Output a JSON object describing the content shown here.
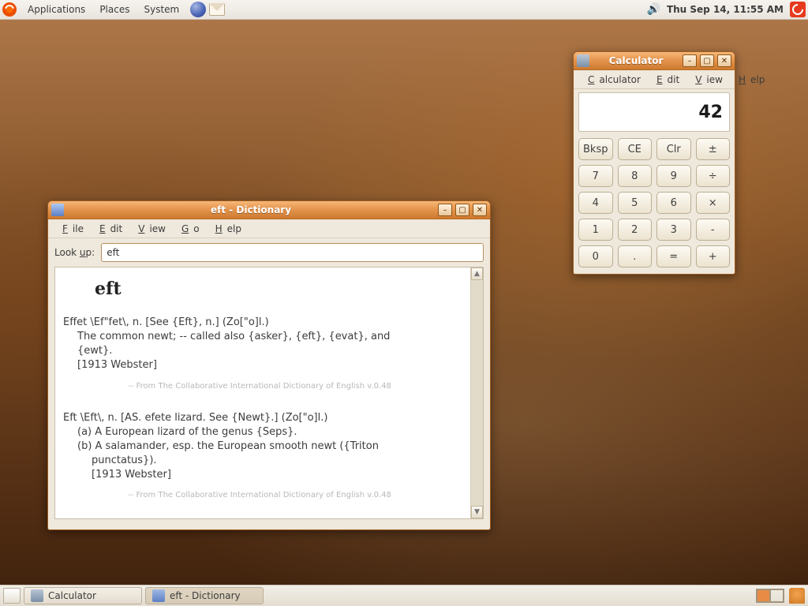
{
  "panel": {
    "menus": {
      "applications": "Applications",
      "places": "Places",
      "system": "System"
    },
    "clock": "Thu Sep 14, 11:55 AM"
  },
  "taskbar": {
    "tasks": [
      {
        "label": "Calculator",
        "active": false,
        "icon": "calc"
      },
      {
        "label": "eft - Dictionary",
        "active": true,
        "icon": "dict"
      }
    ]
  },
  "dictionary": {
    "title": "eft - Dictionary",
    "menus": {
      "file": "File",
      "edit": "Edit",
      "view": "View",
      "go": "Go",
      "help": "Help"
    },
    "lookup_label": "Look up:",
    "lookup_value": "eft",
    "headword": "eft",
    "entry1": {
      "line1": "Effet \\Ef\"fet\\, n. [See {Eft}, n.] (Zo[\"o]l.)",
      "line2": "The common newt; -- called also {asker}, {eft}, {evat}, and",
      "line3": "{ewt}.",
      "line4": "[1913 Webster]",
      "source": "-- From The Collaborative International Dictionary of English v.0.48"
    },
    "entry2": {
      "line1": "Eft \\Eft\\, n. [AS. efete lizard. See {Newt}.] (Zo[\"o]l.)",
      "line2": "(a) A European lizard of the genus {Seps}.",
      "line3": "(b) A salamander, esp. the European smooth newt ({Triton",
      "line4": "punctatus}).",
      "line5": "[1913 Webster]",
      "source": "-- From The Collaborative International Dictionary of English v.0.48"
    }
  },
  "calculator": {
    "title": "Calculator",
    "menus": {
      "calculator": "Calculator",
      "edit": "Edit",
      "view": "View",
      "help": "Help"
    },
    "display": "42",
    "buttons": {
      "bksp": "Bksp",
      "ce": "CE",
      "clr": "Clr",
      "pm": "±",
      "b7": "7",
      "b8": "8",
      "b9": "9",
      "div": "÷",
      "b4": "4",
      "b5": "5",
      "b6": "6",
      "mul": "×",
      "b1": "1",
      "b2": "2",
      "b3": "3",
      "sub": "-",
      "b0": "0",
      "dot": ".",
      "eq": "=",
      "add": "+"
    }
  }
}
